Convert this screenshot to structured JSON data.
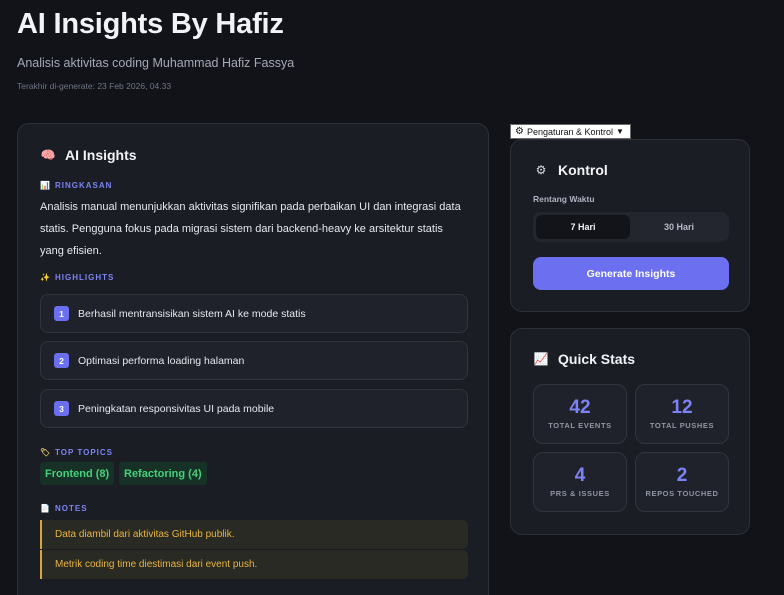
{
  "header": {
    "title": "AI Insights By Hafiz",
    "subtitle": "Analisis aktivitas coding Muhammad Hafiz Fassya",
    "updated": "Terakhir di-generate: 23 Feb 2026, 04.33"
  },
  "insights": {
    "title": "AI Insights",
    "title_icon": "brain-icon",
    "summary_label": "RINGKASAN",
    "summary_icon": "bar-chart-icon",
    "summary_text": "Analisis manual menunjukkan aktivitas signifikan pada perbaikan UI dan integrasi data statis. Pengguna fokus pada migrasi sistem dari backend-heavy ke arsitektur statis yang efisien.",
    "highlights_label": "HIGHLIGHTS",
    "highlights_icon": "sparkles-icon",
    "highlights": [
      {
        "num": "1",
        "text": "Berhasil mentransisikan sistem AI ke mode statis"
      },
      {
        "num": "2",
        "text": "Optimasi performa loading halaman"
      },
      {
        "num": "3",
        "text": "Peningkatan responsivitas UI pada mobile"
      }
    ],
    "topics_label": "TOP TOPICS",
    "topics_icon": "tag-icon",
    "topics": [
      "Frontend (8)",
      "Refactoring (4)"
    ],
    "notes_label": "NOTES",
    "notes_icon": "memo-icon",
    "notes": [
      "Data diambil dari aktivitas GitHub publik.",
      "Metrik coding time diestimasi dari event push."
    ]
  },
  "settings": {
    "toggle_label": "Pengaturan & Kontrol",
    "toggle_icon": "gear-icon",
    "toggle_arrow": "triangle-down-icon"
  },
  "control": {
    "title": "Kontrol",
    "title_icon": "gear-icon",
    "range_label": "Rentang Waktu",
    "range_options": [
      "7 Hari",
      "30 Hari"
    ],
    "range_selected": "7 Hari",
    "generate_label": "Generate Insights"
  },
  "stats": {
    "title": "Quick Stats",
    "title_icon": "chart-increasing-icon",
    "items": [
      {
        "value": "42",
        "label": "TOTAL EVENTS"
      },
      {
        "value": "12",
        "label": "TOTAL PUSHES"
      },
      {
        "value": "4",
        "label": "PRS & ISSUES"
      },
      {
        "value": "2",
        "label": "REPOS TOUCHED"
      }
    ]
  },
  "colors": {
    "background": "#111318",
    "card": "#1a1d24",
    "accent": "#6b6ff0",
    "topic_green": "#43d17a",
    "note_amber": "#e8b43e"
  }
}
